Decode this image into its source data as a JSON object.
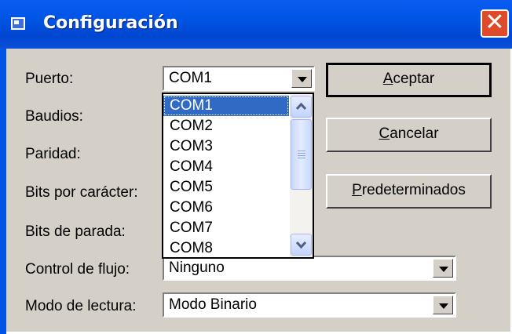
{
  "window": {
    "title": "Configuración",
    "close_label": "✕"
  },
  "labels": {
    "puerto": "Puerto:",
    "baudios": "Baudios:",
    "paridad": "Paridad:",
    "bits_caracter": "Bits por carácter:",
    "bits_parada": "Bits de parada:",
    "control_flujo": "Control de flujo:",
    "modo_lectura": "Modo de lectura:"
  },
  "fields": {
    "puerto_value": "COM1",
    "control_flujo_value": "Ninguno",
    "modo_lectura_value": "Modo Binario"
  },
  "dropdown": {
    "options": [
      "COM1",
      "COM2",
      "COM3",
      "COM4",
      "COM5",
      "COM6",
      "COM7",
      "COM8"
    ],
    "selected": "COM1"
  },
  "buttons": {
    "aceptar": {
      "mnemonic": "A",
      "rest": "ceptar"
    },
    "cancelar": {
      "mnemonic": "C",
      "rest": "ancelar"
    },
    "predeterminados": {
      "mnemonic": "P",
      "rest": "redeterminados"
    }
  },
  "colors": {
    "title_bar": "#0055e5",
    "dialog_bg": "#d4d0c8",
    "selection": "#316ac5",
    "close_button": "#dd4b2a"
  }
}
